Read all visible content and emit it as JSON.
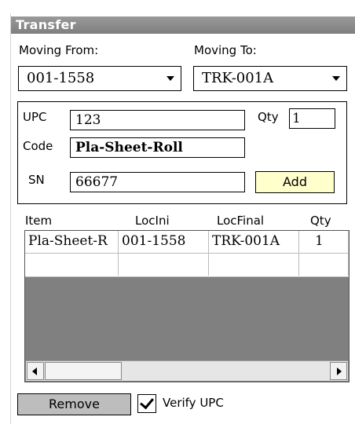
{
  "window": {
    "title": "Transfer"
  },
  "moving_from": {
    "label": "Moving From:",
    "value": "001-1558"
  },
  "moving_to": {
    "label": "Moving To:",
    "value": "TRK-001A"
  },
  "form": {
    "upc_label": "UPC",
    "upc_value": "123",
    "qty_label": "Qty",
    "qty_value": "1",
    "code_label": "Code",
    "code_value": "Pla-Sheet-Roll",
    "sn_label": "SN",
    "sn_value": "66677",
    "add_label": "Add"
  },
  "table": {
    "columns": [
      "Item",
      "LocIni",
      "LocFinal",
      "Qty"
    ],
    "rows": [
      [
        "Pla-Sheet-R",
        "001-1558",
        "TRK-001A",
        "1"
      ]
    ]
  },
  "footer": {
    "remove_label": "Remove",
    "verify_label": "Verify UPC",
    "verify_checked": true
  },
  "colors": {
    "title_bar": "#8a8a8a",
    "add_button": "#ffffcc",
    "remove_button": "#bdbdbd",
    "grid_empty": "#808080"
  }
}
